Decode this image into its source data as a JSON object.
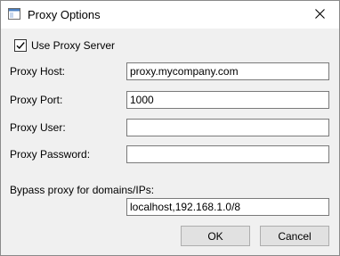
{
  "window": {
    "title": "Proxy Options"
  },
  "use_proxy": {
    "label": "Use Proxy Server",
    "checked": true
  },
  "fields": {
    "host": {
      "label": "Proxy Host:",
      "value": "proxy.mycompany.com"
    },
    "port": {
      "label": "Proxy Port:",
      "value": "1000"
    },
    "user": {
      "label": "Proxy User:",
      "value": ""
    },
    "password": {
      "label": "Proxy Password:",
      "value": ""
    }
  },
  "bypass": {
    "label": "Bypass proxy for domains/IPs:",
    "value": "localhost,192.168.1.0/8"
  },
  "buttons": {
    "ok": "OK",
    "cancel": "Cancel"
  },
  "icons": {
    "app": "window-icon",
    "close": "close-icon",
    "check": "checkmark-icon"
  }
}
